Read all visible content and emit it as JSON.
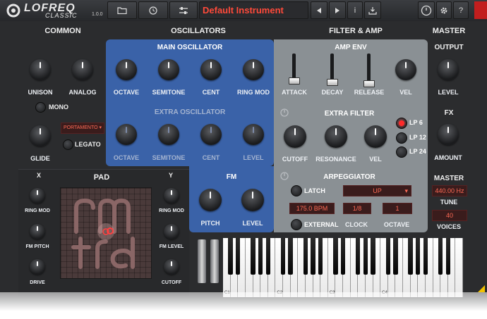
{
  "topbar": {
    "logo_main": "LOFREQ",
    "logo_sub": "CLASSIC",
    "version": "1.0.0",
    "preset_name": "Default Instrument",
    "icons": [
      "folder-icon",
      "clock-icon",
      "sliders-icon",
      "prev-icon",
      "next-icon",
      "info-icon",
      "save-icon",
      "power-icon",
      "gear-icon",
      "help-icon"
    ],
    "help_label": "?",
    "info_label": "i"
  },
  "sections": {
    "common": "COMMON",
    "oscillators": "OSCILLATORS",
    "filter_amp": "FILTER & AMP",
    "master": "MASTER"
  },
  "common": {
    "unison": "UNISON",
    "analog": "ANALOG",
    "mono": "MONO",
    "glide": "GLIDE",
    "portamento": "PORTAMENTO",
    "legato": "LEGATO"
  },
  "main_osc": {
    "title": "MAIN OSCILLATOR",
    "octave": "OCTAVE",
    "semitone": "SEMITONE",
    "cent": "CENT",
    "ring_mod": "RING MOD"
  },
  "extra_osc": {
    "title": "EXTRA OSCILLATOR",
    "octave": "OCTAVE",
    "semitone": "SEMITONE",
    "cent": "CENT",
    "level": "LEVEL"
  },
  "amp_env": {
    "title": "AMP ENV",
    "attack": "ATTACK",
    "decay": "DECAY",
    "release": "RELEASE",
    "vel": "VEL"
  },
  "extra_filter": {
    "title": "EXTRA FILTER",
    "cutoff": "CUTOFF",
    "resonance": "RESONANCE",
    "vel": "VEL",
    "lp6": "LP 6",
    "lp12": "LP 12",
    "lp24": "LP 24",
    "selected": "LP 6"
  },
  "fm": {
    "title": "FM",
    "pitch": "PITCH",
    "level": "LEVEL"
  },
  "arp": {
    "title": "ARPEGGIATOR",
    "latch": "LATCH",
    "mode": "UP",
    "bpm": "175.0 BPM",
    "clock_value": "1/8",
    "octave_value": "1",
    "external": "EXTERNAL",
    "clock": "CLOCK",
    "octave": "OCTAVE"
  },
  "pad": {
    "title": "PAD",
    "x": "X",
    "y": "Y",
    "x_ring_mod": "RING MOD",
    "x_fm_pitch": "FM PITCH",
    "x_drive": "DRIVE",
    "y_ring_mod": "RING MOD",
    "y_fm_level": "FM LEVEL",
    "y_cutoff": "CUTOFF"
  },
  "master": {
    "output": "OUTPUT",
    "level": "LEVEL",
    "fx": "FX",
    "amount": "AMOUNT",
    "master_title": "MASTER",
    "hz": "440.00 Hz",
    "tune": "TUNE",
    "voices_value": "40",
    "voices": "VOICES"
  },
  "keyboard": {
    "c1": "C1",
    "c2": "C2",
    "c3": "C3",
    "c4": "C4"
  },
  "colors": {
    "preset_red": "#ff4a3a",
    "blue_panel": "#3a62a8",
    "gray_panel": "#8a9094",
    "lcd_red": "#ff6a55"
  }
}
